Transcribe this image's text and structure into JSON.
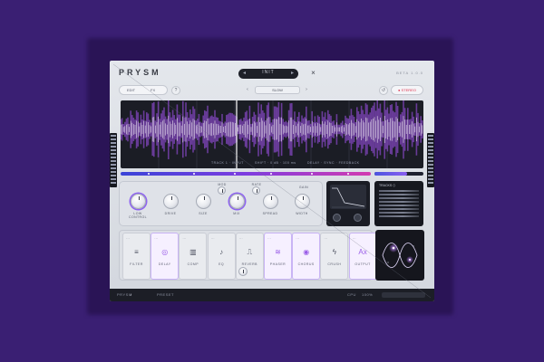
{
  "app": {
    "logo": "PRYSM",
    "version": "BETA 1.0.0"
  },
  "header": {
    "preset_name": "INIT",
    "prev_arrow": "◂",
    "next_arrow": "▸",
    "close_icon": "×",
    "mode_left": "EDIT",
    "mode_right": "FX",
    "help_icon": "?",
    "selector_value": "SLOW",
    "selector_arrow_left": "‹",
    "selector_arrow_right": "›",
    "reset_icon": "↺",
    "record_label": "● STEREO"
  },
  "waveform": {
    "labels": [
      "TRACK 1 · INPUT",
      "SHIFT · 0 dB · 100 ms",
      "DELAY · SYNC · FEEDBACK"
    ],
    "colors": {
      "glow": "#a855f7",
      "core": "#ffffff"
    }
  },
  "knobs": [
    {
      "label": "LOW CONTROL"
    },
    {
      "label": "DRIVE"
    },
    {
      "label": "SIZE"
    },
    {
      "label": "MIX"
    },
    {
      "label": "SPREAD"
    },
    {
      "label": "WIDTH"
    },
    {
      "label": "GAIN"
    }
  ],
  "small_knobs": [
    {
      "label": "MOD"
    },
    {
      "label": "RATE"
    }
  ],
  "grid_panel": {
    "title": "TRACKS ⬡"
  },
  "modules": [
    {
      "label": "FILTER",
      "icon": "≡",
      "active": false
    },
    {
      "label": "DELAY",
      "icon": "◎",
      "active": true
    },
    {
      "label": "COMP",
      "icon": "▥",
      "active": false
    },
    {
      "label": "EQ",
      "icon": "♪",
      "active": false
    },
    {
      "label": "REVERB",
      "icon": "⎍",
      "active": false
    },
    {
      "label": "PHASER",
      "icon": "≋",
      "active": true
    },
    {
      "label": "CHORUS",
      "icon": "◉",
      "active": true
    },
    {
      "label": "CRUSH",
      "icon": "ϟ",
      "active": false
    },
    {
      "label": "OUTPUT",
      "icon": "Ax",
      "active": true
    }
  ],
  "footer": {
    "left_label": "PRYSM",
    "mid_label": "PRESET",
    "right_label": "CPU",
    "zoom": "100%"
  },
  "colors": {
    "accent": "#8e63f0",
    "background": "#3a1f73",
    "record": "#e0344f"
  }
}
